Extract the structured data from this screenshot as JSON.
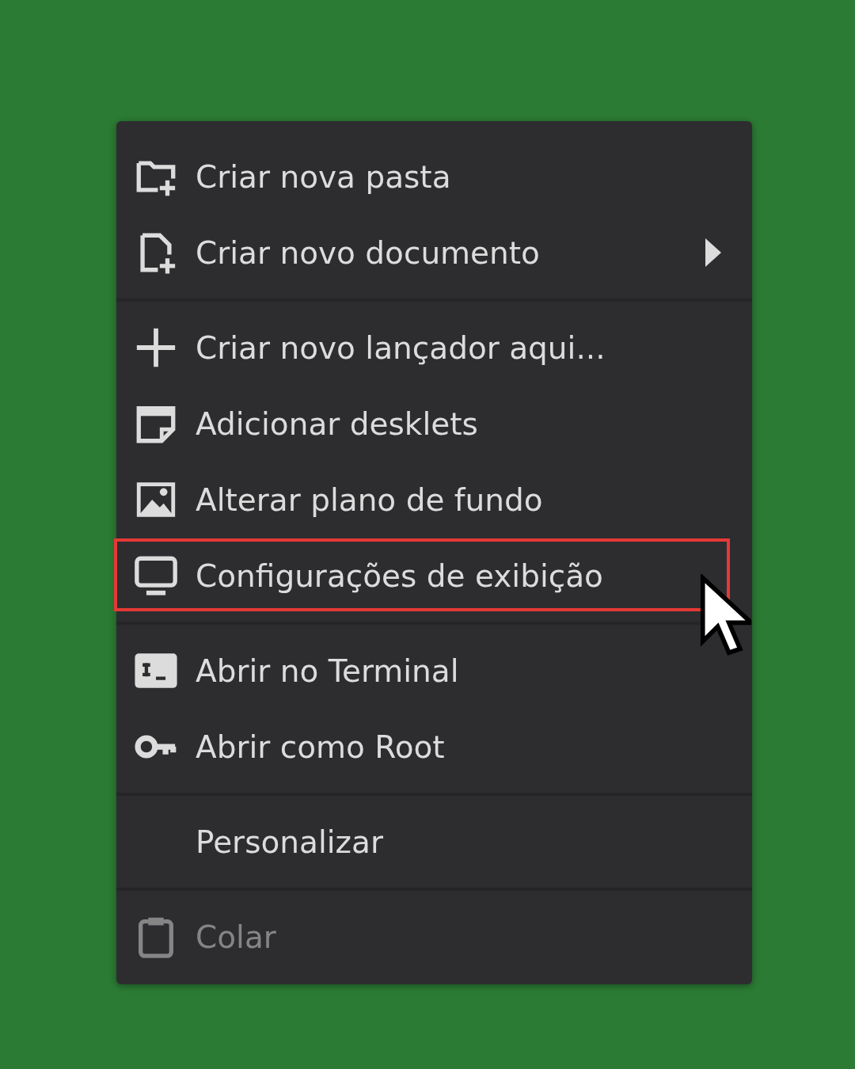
{
  "menu": {
    "sections": [
      {
        "items": [
          {
            "label": "Criar nova pasta",
            "submenu": false,
            "disabled": false,
            "annotated": false
          },
          {
            "label": "Criar novo documento",
            "submenu": true,
            "disabled": false,
            "annotated": false
          }
        ]
      },
      {
        "items": [
          {
            "label": "Criar novo lançador aqui...",
            "submenu": false,
            "disabled": false,
            "annotated": false
          },
          {
            "label": "Adicionar desklets",
            "submenu": false,
            "disabled": false,
            "annotated": false
          },
          {
            "label": "Alterar plano de fundo",
            "submenu": false,
            "disabled": false,
            "annotated": false
          },
          {
            "label": "Configurações de exibição",
            "submenu": false,
            "disabled": false,
            "annotated": true
          }
        ]
      },
      {
        "items": [
          {
            "label": "Abrir no Terminal",
            "submenu": false,
            "disabled": false,
            "annotated": false
          },
          {
            "label": "Abrir como Root",
            "submenu": false,
            "disabled": false,
            "annotated": false
          }
        ]
      },
      {
        "items": [
          {
            "label": "Personalizar",
            "submenu": false,
            "disabled": false,
            "annotated": false
          }
        ]
      },
      {
        "items": [
          {
            "label": "Colar",
            "submenu": false,
            "disabled": true,
            "annotated": false
          }
        ]
      }
    ]
  }
}
